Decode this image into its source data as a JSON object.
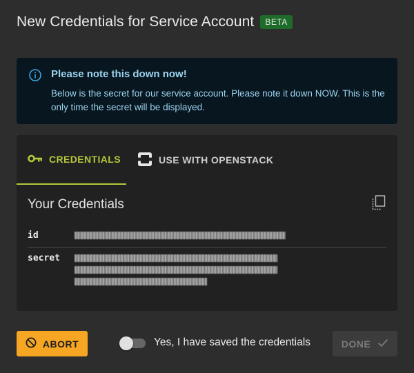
{
  "dialog": {
    "title": "New Credentials for Service Account",
    "badge": "BETA"
  },
  "note": {
    "icon": "info-icon",
    "title": "Please note this down now!",
    "body": "Below is the secret for our service account. Please note it down NOW. This is the only time the secret will be displayed."
  },
  "tabs": [
    {
      "label": "CREDENTIALS",
      "icon": "key-icon",
      "active": true
    },
    {
      "label": "USE WITH OPENSTACK",
      "icon": "openstack-icon",
      "active": false
    }
  ],
  "credentials": {
    "title": "Your Credentials",
    "copy_icon": "copy-icon",
    "rows": [
      {
        "label": "id"
      },
      {
        "label": "secret"
      }
    ]
  },
  "footer": {
    "abort_label": "ABORT",
    "toggle_label": "Yes, I have saved the credentials",
    "toggle_on": false,
    "done_label": "DONE"
  },
  "colors": {
    "background": "#2d2d2d",
    "note_background": "#07161f",
    "note_text": "#9ed3ef",
    "tab_active": "#b6c73c",
    "abort": "#f6a623",
    "badge": "#1f6b2a"
  }
}
